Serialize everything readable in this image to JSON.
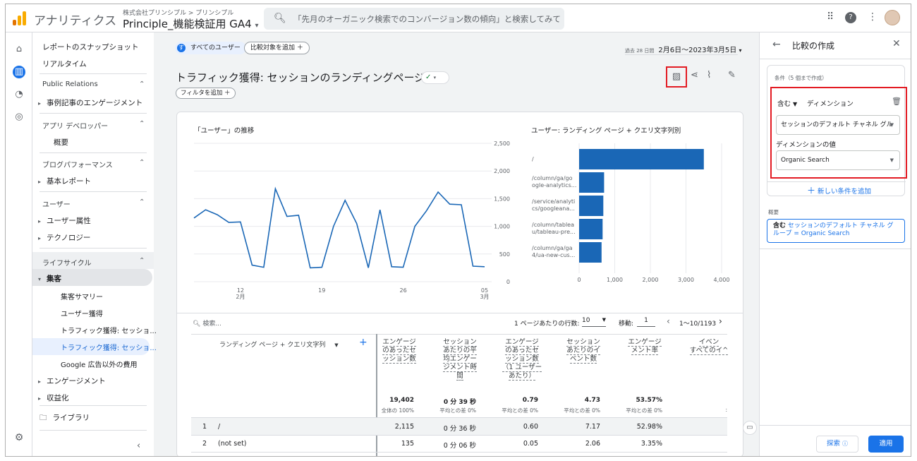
{
  "topbar": {
    "app_title": "アナリティクス",
    "account_path": "株式会社プリンシプル > プリンシプル",
    "property": "Principle_機能検証用 GA4",
    "search_placeholder": "「先月のオーガニック検索でのコンバージョン数の傾向」と検索してみてく...",
    "icons": [
      "apps-grid-icon",
      "help-icon",
      "more-vert-icon",
      "avatar"
    ]
  },
  "nav": {
    "snapshot": "レポートのスナップショット",
    "realtime": "リアルタイム",
    "groups": [
      {
        "title": "Public Relations",
        "items": [
          "事例記事のエンゲージメント"
        ]
      },
      {
        "title": "アプリ デベロッパー",
        "items": [
          "概要"
        ]
      },
      {
        "title": "ブログパフォーマンス",
        "items": [
          "基本レポート"
        ]
      },
      {
        "title": "ユーザー",
        "items": [
          "ユーザー属性",
          "テクノロジー"
        ]
      },
      {
        "title": "ライフサイクル",
        "items": [
          "集客",
          "集客サマリー",
          "ユーザー獲得",
          "トラフィック獲得: セッショ...",
          "トラフィック獲得: セッショ...",
          "Google 広告以外の費用",
          "エンゲージメント",
          "収益化"
        ]
      }
    ],
    "library": "ライブラリ"
  },
  "main": {
    "chip_all_users": "すべてのユーザー",
    "chip_compare": "比較対象を追加",
    "date_prefix": "過去 28 日間",
    "date_range": "2月6日～2023年3月5日",
    "title": "トラフィック獲得: セッションのランディングページ",
    "filter_chip": "フィルタを追加"
  },
  "chart_data": [
    {
      "type": "line",
      "title": "「ユーザー」の推移",
      "x_ticks": [
        "12\n2月",
        "19",
        "26",
        "05\n3月"
      ],
      "y_ticks": [
        "0",
        "500",
        "1,000",
        "1,500",
        "2,000",
        "2,500"
      ],
      "ylim": [
        0,
        2500
      ],
      "values": [
        1150,
        1300,
        1210,
        1070,
        1080,
        300,
        260,
        1680,
        1180,
        1200,
        250,
        260,
        1000,
        1470,
        1050,
        250,
        1300,
        270,
        260,
        1000,
        1280,
        1620,
        1400,
        1390,
        280,
        270
      ],
      "color": "#1a67b6"
    },
    {
      "type": "bar",
      "title": "ユーザー: ランディング ページ + クエリ文字列別",
      "categories": [
        "/",
        "/column/ga/go\nogle-analytics...",
        "/service/analyti\ncs/googleana...",
        "/column/tablea\nu/tableau-pre...",
        "/column/ga/ga\n4/ua-new-cus..."
      ],
      "values": [
        3500,
        700,
        680,
        660,
        630
      ],
      "x_ticks": [
        "0",
        "1,000",
        "2,000",
        "3,000",
        "4,000"
      ],
      "xlim": [
        0,
        4000
      ],
      "color": "#1a67b6"
    }
  ],
  "table": {
    "search_placeholder": "検索...",
    "rows_per_page_label": "1 ページあたりの行数:",
    "rows_per_page": "10",
    "goto_label": "移動:",
    "goto_value": "1",
    "range": "1～10/1193",
    "dim_header": "ランディング ページ + クエリ文字列",
    "headers": [
      "エンゲージ\nのあったセ\nッション数",
      "セッション\nあたりの平\n均エンゲー\nジメント時\n間",
      "エンゲージ\nのあったセ\nッション数\n（1 ユーザー\nあたり）",
      "セッション\nあたりのイ\nベント数",
      "エンゲージ\nメント率",
      "イベン\nすべてのイ^"
    ],
    "totals": [
      "19,402",
      "0 分 39 秒",
      "0.79",
      "4.73",
      "53.57%"
    ],
    "totals_sub": [
      "全体の 100%",
      "平均との差 0%",
      "平均との差 0%",
      "平均との差 0%",
      "平均との差 0%"
    ],
    "rows": [
      {
        "n": "1",
        "dim": "/",
        "vals": [
          "2,115",
          "0 分 36 秒",
          "0.60",
          "7.17",
          "52.98%"
        ]
      },
      {
        "n": "2",
        "dim": "(not set)",
        "vals": [
          "135",
          "0 分 06 秒",
          "0.05",
          "2.06",
          "3.35%"
        ]
      }
    ]
  },
  "panel": {
    "title": "比較の作成",
    "conditions_label": "条件（5 個まで作成）",
    "include": "含む",
    "dimension_label": "ディメンション",
    "dimension_value": "セッションのデフォルト チャネル グル",
    "value_label": "ディメンションの値",
    "value": "Organic Search",
    "add_condition": "新しい条件を追加",
    "summary_label": "概要",
    "summary_include": "含む",
    "summary_text": "セッションのデフォルト チャネル グループ = Organic Search",
    "explore_button": "探索",
    "apply_button": "適用"
  }
}
